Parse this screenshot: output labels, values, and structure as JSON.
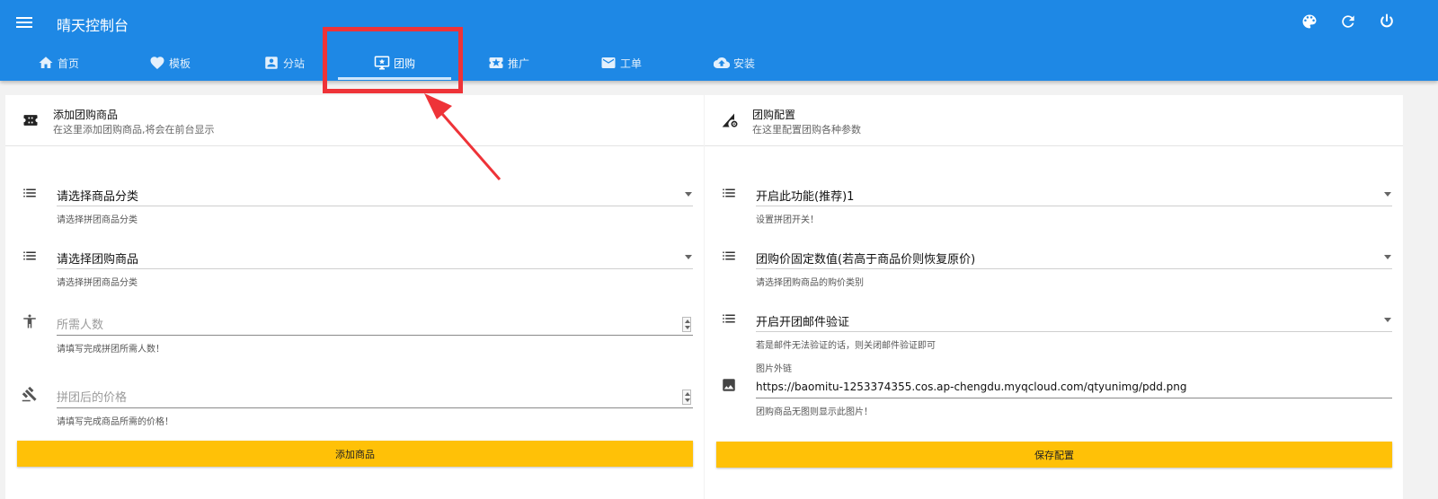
{
  "header": {
    "title": "晴天控制台",
    "icons": [
      "menu-icon",
      "palette-icon",
      "refresh-icon",
      "power-icon"
    ],
    "accent": "#1e88e5"
  },
  "tabs": [
    {
      "label": "首页",
      "icon": "home-icon"
    },
    {
      "label": "模板",
      "icon": "heart-icon"
    },
    {
      "label": "分站",
      "icon": "account-box-icon"
    },
    {
      "label": "团购",
      "icon": "monitor-star-icon",
      "active": true
    },
    {
      "label": "推广",
      "icon": "ticket-star-icon"
    },
    {
      "label": "工单",
      "icon": "mail-icon"
    },
    {
      "label": "安装",
      "icon": "cloud-upload-icon"
    }
  ],
  "left_card": {
    "title": "添加团购商品",
    "subtitle": "在这里添加团购商品,将会在前台显示",
    "fields": [
      {
        "type": "select",
        "value": "请选择商品分类",
        "help": "请选择拼团商品分类"
      },
      {
        "type": "select",
        "value": "请选择团购商品",
        "help": "请选择拼团商品分类"
      },
      {
        "type": "number",
        "placeholder": "所需人数",
        "help": "请填写完成拼团所需人数！"
      },
      {
        "type": "number",
        "placeholder": "拼团后的价格",
        "help": "请填写完成商品所需的价格！"
      }
    ],
    "button": "添加商品"
  },
  "right_card": {
    "title": "团购配置",
    "subtitle": "在这里配置团购各种参数",
    "fields": [
      {
        "type": "select",
        "value": "开启此功能(推荐)1",
        "help": "设置拼团开关！"
      },
      {
        "type": "select",
        "value": "团购价固定数值(若高于商品价则恢复原价)",
        "help": "请选择团购商品的购价类别"
      },
      {
        "type": "select",
        "value": "开启开团邮件验证",
        "help": "若是邮件无法验证的话，则关闭邮件验证即可"
      },
      {
        "type": "text",
        "label": "图片外链",
        "value": "https://baomitu-1253374355.cos.ap-chengdu.myqcloud.com/qtyunimg/pdd.png",
        "help": "团购商品无图则显示此图片！"
      }
    ],
    "button": "保存配置"
  },
  "colors": {
    "button": "#ffc107",
    "annotation": "#ee3338"
  }
}
